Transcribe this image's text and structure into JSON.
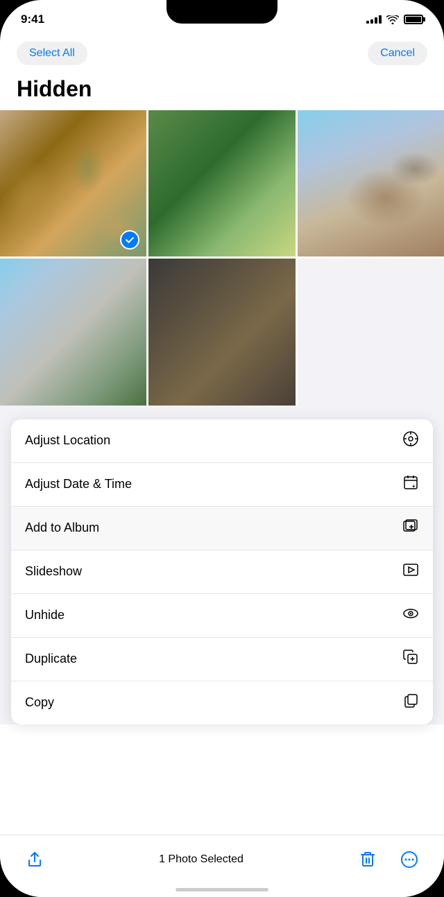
{
  "status": {
    "time": "9:41",
    "signal_bars": [
      4,
      6,
      8,
      10,
      12
    ],
    "battery_full": true
  },
  "header": {
    "select_all_label": "Select All",
    "cancel_label": "Cancel",
    "title": "Hidden"
  },
  "photos": [
    {
      "id": "photo-1",
      "selected": true,
      "css_class": "photo-1"
    },
    {
      "id": "photo-2",
      "selected": false,
      "css_class": "photo-2"
    },
    {
      "id": "photo-3",
      "selected": false,
      "css_class": "photo-3"
    },
    {
      "id": "photo-4",
      "selected": false,
      "css_class": "photo-4"
    },
    {
      "id": "photo-5",
      "selected": false,
      "css_class": "photo-5"
    }
  ],
  "menu": {
    "items": [
      {
        "id": "adjust-location",
        "label": "Adjust Location",
        "icon": "⊙"
      },
      {
        "id": "adjust-date-time",
        "label": "Adjust Date & Time",
        "icon": "📅+"
      },
      {
        "id": "add-to-album",
        "label": "Add to Album",
        "icon": "⊕"
      },
      {
        "id": "slideshow",
        "label": "Slideshow",
        "icon": "▶"
      },
      {
        "id": "unhide",
        "label": "Unhide",
        "icon": "👁"
      },
      {
        "id": "duplicate",
        "label": "Duplicate",
        "icon": "⊕"
      },
      {
        "id": "copy",
        "label": "Copy",
        "icon": "📋"
      }
    ]
  },
  "toolbar": {
    "share_label": "Share",
    "status_text": "1 Photo Selected",
    "delete_label": "Delete",
    "more_label": "More"
  },
  "colors": {
    "accent": "#007AFF",
    "destructive": "#FF3B30",
    "label": "#000000",
    "secondary_label": "#3C3C43",
    "separator": "#e5e5ea",
    "grouped_bg": "#f2f2f7"
  }
}
